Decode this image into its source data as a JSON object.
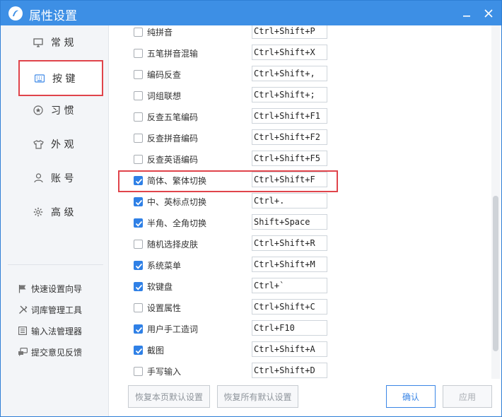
{
  "window": {
    "title": "属性设置"
  },
  "sidebar": {
    "nav": [
      {
        "label": "常 规",
        "icon": "monitor-icon"
      },
      {
        "label": "按 键",
        "icon": "keyboard-icon",
        "active": true
      },
      {
        "label": "习 惯",
        "icon": "star-icon"
      },
      {
        "label": "外 观",
        "icon": "shirt-icon"
      },
      {
        "label": "账 号",
        "icon": "user-icon"
      },
      {
        "label": "高 级",
        "icon": "gear-icon"
      }
    ],
    "tools": [
      {
        "label": "快速设置向导",
        "icon": "flag-icon"
      },
      {
        "label": "词库管理工具",
        "icon": "tools-icon"
      },
      {
        "label": "输入法管理器",
        "icon": "list-icon"
      },
      {
        "label": "提交意见反馈",
        "icon": "chat-icon"
      }
    ]
  },
  "shortcuts": [
    {
      "label": "纯拼音",
      "key": "Ctrl+Shift+P",
      "checked": false
    },
    {
      "label": "五笔拼音混输",
      "key": "Ctrl+Shift+X",
      "checked": false
    },
    {
      "label": "编码反查",
      "key": "Ctrl+Shift+,",
      "checked": false
    },
    {
      "label": "词组联想",
      "key": "Ctrl+Shift+;",
      "checked": false
    },
    {
      "label": "反查五笔编码",
      "key": "Ctrl+Shift+F1",
      "checked": false
    },
    {
      "label": "反查拼音编码",
      "key": "Ctrl+Shift+F2",
      "checked": false
    },
    {
      "label": "反查英语编码",
      "key": "Ctrl+Shift+F5",
      "checked": false
    },
    {
      "label": "简体、繁体切换",
      "key": "Ctrl+Shift+F",
      "checked": true
    },
    {
      "label": "中、英标点切换",
      "key": "Ctrl+.",
      "checked": true
    },
    {
      "label": "半角、全角切换",
      "key": "Shift+Space",
      "checked": true
    },
    {
      "label": "随机选择皮肤",
      "key": "Ctrl+Shift+R",
      "checked": false
    },
    {
      "label": "系统菜单",
      "key": "Ctrl+Shift+M",
      "checked": true
    },
    {
      "label": "软键盘",
      "key": "Ctrl+`",
      "checked": true
    },
    {
      "label": "设置属性",
      "key": "Ctrl+Shift+C",
      "checked": false
    },
    {
      "label": "用户手工造词",
      "key": "Ctrl+F10",
      "checked": true
    },
    {
      "label": "截图",
      "key": "Ctrl+Shift+A",
      "checked": true
    },
    {
      "label": "手写输入",
      "key": "Ctrl+Shift+D",
      "checked": false
    }
  ],
  "footer": {
    "restore_page": "恢复本页默认设置",
    "restore_all": "恢复所有默认设置",
    "confirm": "确认",
    "apply": "应用"
  },
  "colors": {
    "titlebar": "#3d8fe5",
    "accent": "#2f80e6",
    "highlight": "#e0444b"
  }
}
